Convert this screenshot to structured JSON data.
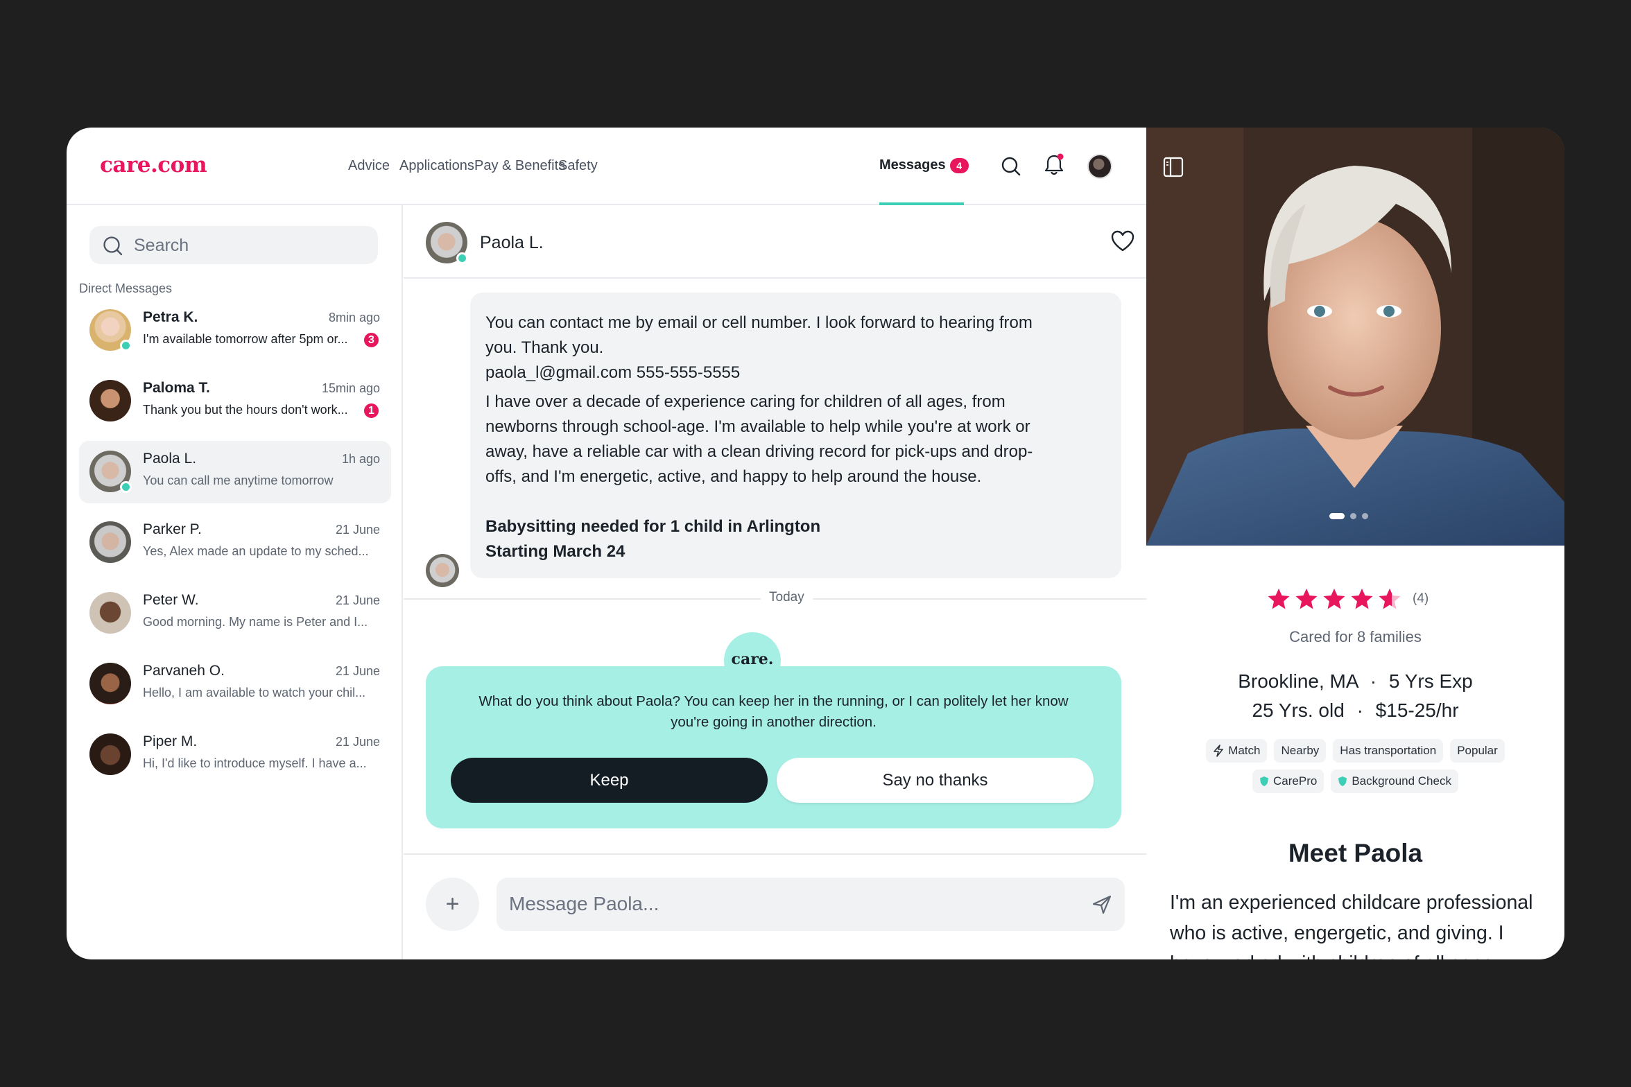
{
  "brand": {
    "logo_text": "care.com",
    "accent": "#e8175d",
    "teal": "#3ccfb6"
  },
  "nav": {
    "items": [
      {
        "label": "Advice"
      },
      {
        "label": "Applications"
      },
      {
        "label": "Pay & Benefits"
      },
      {
        "label": "Safety"
      },
      {
        "label": "Messages",
        "badge": "4",
        "active": true
      }
    ],
    "icons": [
      "search-icon",
      "bell-icon",
      "user-avatar"
    ]
  },
  "sidebar": {
    "search_placeholder": "Search",
    "section_label": "Direct Messages",
    "conversations": [
      {
        "name": "Petra K.",
        "time": "8min ago",
        "preview": "I'm available tomorrow after 5pm or...",
        "unread": "3",
        "online": true
      },
      {
        "name": "Paloma T.",
        "time": "15min ago",
        "preview": "Thank you but the hours don't work...",
        "unread": "1",
        "online": false
      },
      {
        "name": "Paola L.",
        "time": "1h ago",
        "preview": "You can call me anytime tomorrow",
        "unread": "",
        "online": true,
        "active": true
      },
      {
        "name": "Parker P.",
        "time": "21 June",
        "preview": "Yes, Alex made an update to my sched...",
        "unread": "",
        "online": false
      },
      {
        "name": "Peter W.",
        "time": "21 June",
        "preview": "Good morning. My name is Peter and I...",
        "unread": "",
        "online": false
      },
      {
        "name": "Parvaneh O.",
        "time": "21 June",
        "preview": "Hello, I am available to watch your chil...",
        "unread": "",
        "online": false
      },
      {
        "name": "Piper M.",
        "time": "21 June",
        "preview": "Hi, I'd like to introduce myself. I have a...",
        "unread": "",
        "online": false
      }
    ]
  },
  "chat": {
    "contact_name": "Paola L.",
    "message_lines": [
      "You can contact me by email or cell number. I look forward to hearing from",
      "you. Thank you.",
      "paola_l@gmail.com 555-555-5555",
      "I have over a decade of experience caring for children of all ages, from",
      "newborns through school-age. I'm available to help while you're at work or",
      "away, have a reliable car with a clean driving record for pick-ups and drop-",
      "offs, and I'm energetic, active, and happy to help around the house."
    ],
    "job_title": "Babysitting needed for 1 child in Arlington",
    "job_start": "Starting March 24",
    "divider_label": "Today",
    "care_badge": "care.",
    "care_prompt_line1": "What do you think about Paola? You can keep her in the running, or I can politely let her know",
    "care_prompt_line2": "you're going in another direction.",
    "keep_label": "Keep",
    "no_thanks_label": "Say no thanks",
    "input_placeholder": "Message Paola...",
    "add_label": "+"
  },
  "profile": {
    "rating": 4.5,
    "rating_count": "(4)",
    "cared_for": "Cared for 8 families",
    "location": "Brookline, MA",
    "experience": "5 Yrs Exp",
    "age": "25 Yrs. old",
    "rate": "$15-25/hr",
    "separator": "·",
    "tags_row1": [
      "Match",
      "Nearby",
      "Has transportation",
      "Popular"
    ],
    "tags_row2": [
      "CarePro",
      "Background Check"
    ],
    "heading": "Meet Paola",
    "bio": "I'm an experienced childcare professional who is active, engergetic, and giving. I have worked with children of all ages",
    "photo_dots_active": 0,
    "photo_dots_total": 3
  }
}
